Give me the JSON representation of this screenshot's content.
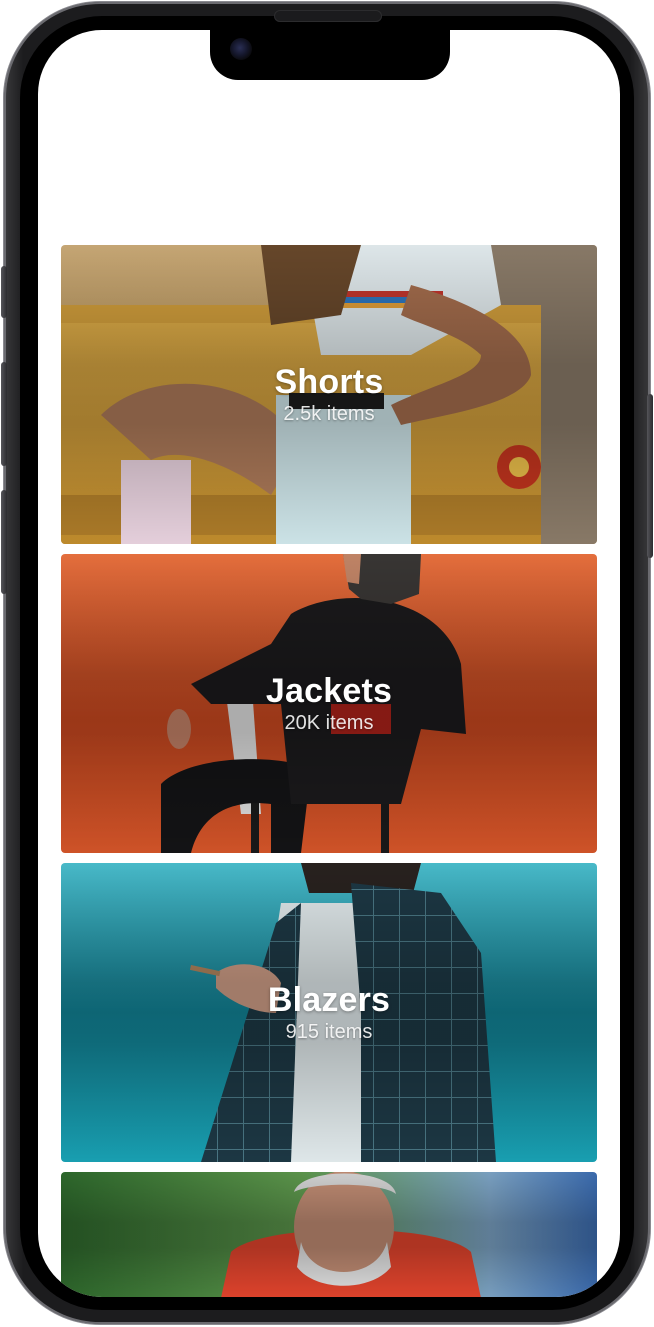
{
  "categories": [
    {
      "title": "Shorts",
      "count": "2.5k items",
      "photo": "shorts-photo",
      "colors": {
        "bg": "#d9a94a",
        "accent": "#e7eef2"
      }
    },
    {
      "title": "Jackets",
      "count": "20K items",
      "photo": "jackets-photo",
      "colors": {
        "bg": "#dd5a2c",
        "accent": "#1a1a1c"
      }
    },
    {
      "title": "Blazers",
      "count": "915 items",
      "photo": "blazers-photo",
      "colors": {
        "bg": "#1d93a8",
        "accent": "#1e3340"
      }
    },
    {
      "title": "",
      "count": "",
      "photo": "tracksuits-photo",
      "colors": {
        "bg": "#3f7d3a",
        "accent": "#e8462e"
      }
    }
  ],
  "device": {
    "frame_color": "#1c1c1e",
    "screen_color": "#ffffff"
  }
}
